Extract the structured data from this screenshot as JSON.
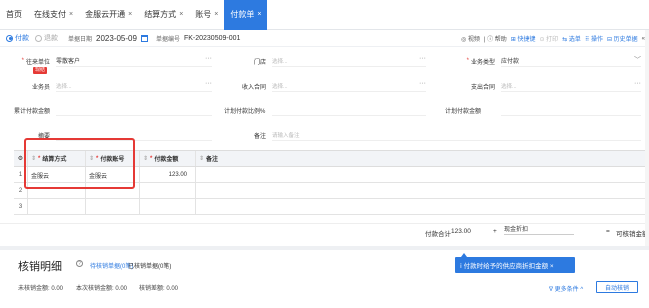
{
  "tabs": [
    {
      "label": "首页",
      "closable": false
    },
    {
      "label": "在线支付",
      "closable": true
    },
    {
      "label": "金服云开通",
      "closable": true
    },
    {
      "label": "结算方式",
      "closable": true
    },
    {
      "label": "账号",
      "closable": true
    },
    {
      "label": "付款单",
      "closable": true,
      "active": true
    }
  ],
  "close_glyph": "×",
  "colors": {
    "accent": "#2d7ae0",
    "danger": "#e53935"
  },
  "toolbar": {
    "radio_pay": "付款",
    "radio_refund": "退款",
    "date_label": "单据日期",
    "date_value": "2023-05-09",
    "docno_label": "单据编号",
    "docno_value": "FK-20230509-001",
    "actions": {
      "video": "◎ 视频",
      "help": "| ⓘ 帮助",
      "shortcut": "⊞ 快捷键",
      "print": "⊙ 打印",
      "select_doc": "⇆ 选单",
      "operate": "⠿ 操作",
      "history": "⊟ 历史单据",
      "collapse": "«"
    }
  },
  "form": {
    "row1": {
      "vendor_label": "往来单位",
      "vendor_value": "零散客户",
      "vendor_badge": "现结",
      "store_label": "门店",
      "store_placeholder": "选择...",
      "biztype_label": "业务类型",
      "biztype_value": "应付款"
    },
    "row2": {
      "salesman_label": "业务员",
      "salesman_placeholder": "选择...",
      "income_contract_label": "收入合同",
      "income_contract_placeholder": "选择...",
      "expense_contract_label": "支出合同",
      "expense_contract_placeholder": "选择..."
    },
    "row3": {
      "cum_paid_label": "累计付款金额",
      "plan_ratio_label": "计划付款比例%",
      "plan_amount_label": "计划付款金额"
    },
    "row4": {
      "summary_label": "摘要",
      "remark_label": "备注",
      "remark_placeholder": "请输入备注"
    },
    "more_glyph": "···",
    "dropdown_glyph": "﹀"
  },
  "grid": {
    "columns": [
      {
        "label": "",
        "required": false
      },
      {
        "label": "结算方式",
        "required": true
      },
      {
        "label": "付款账号",
        "required": true
      },
      {
        "label": "付款金额",
        "required": true
      },
      {
        "label": "备注",
        "required": false
      }
    ],
    "row_index_glyph": "⚙",
    "sort_glyph": "⇕",
    "required_glyph": "*",
    "rows": [
      {
        "no": "1",
        "method": "金服云",
        "account": "金服云",
        "amount": "123.00",
        "remark": ""
      },
      {
        "no": "2",
        "method": "",
        "account": "",
        "amount": "",
        "remark": ""
      },
      {
        "no": "3",
        "method": "",
        "account": "",
        "amount": "",
        "remark": ""
      }
    ]
  },
  "totals": {
    "total_label": "付款合计",
    "total_value": "123.00",
    "plus": "+",
    "discount_label": "现金折扣",
    "equals": "=",
    "writeoff_label": "可核销金额"
  },
  "bottom": {
    "title": "核销明细",
    "help_glyph": "?",
    "tab_pending": "待核销单据(0笔)",
    "tab_done": "已核销单据(0笔)",
    "stat_unwritten": "未核销金额: 0.00",
    "stat_current": "本次核销金额: 0.00",
    "stat_diff": "核销差额: 0.00",
    "tooltip": "ⅰ 付款时给予的供应商折扣金额 ×",
    "more_filter": "∇ 更多条件 ^",
    "auto_writeoff": "自动核销"
  }
}
